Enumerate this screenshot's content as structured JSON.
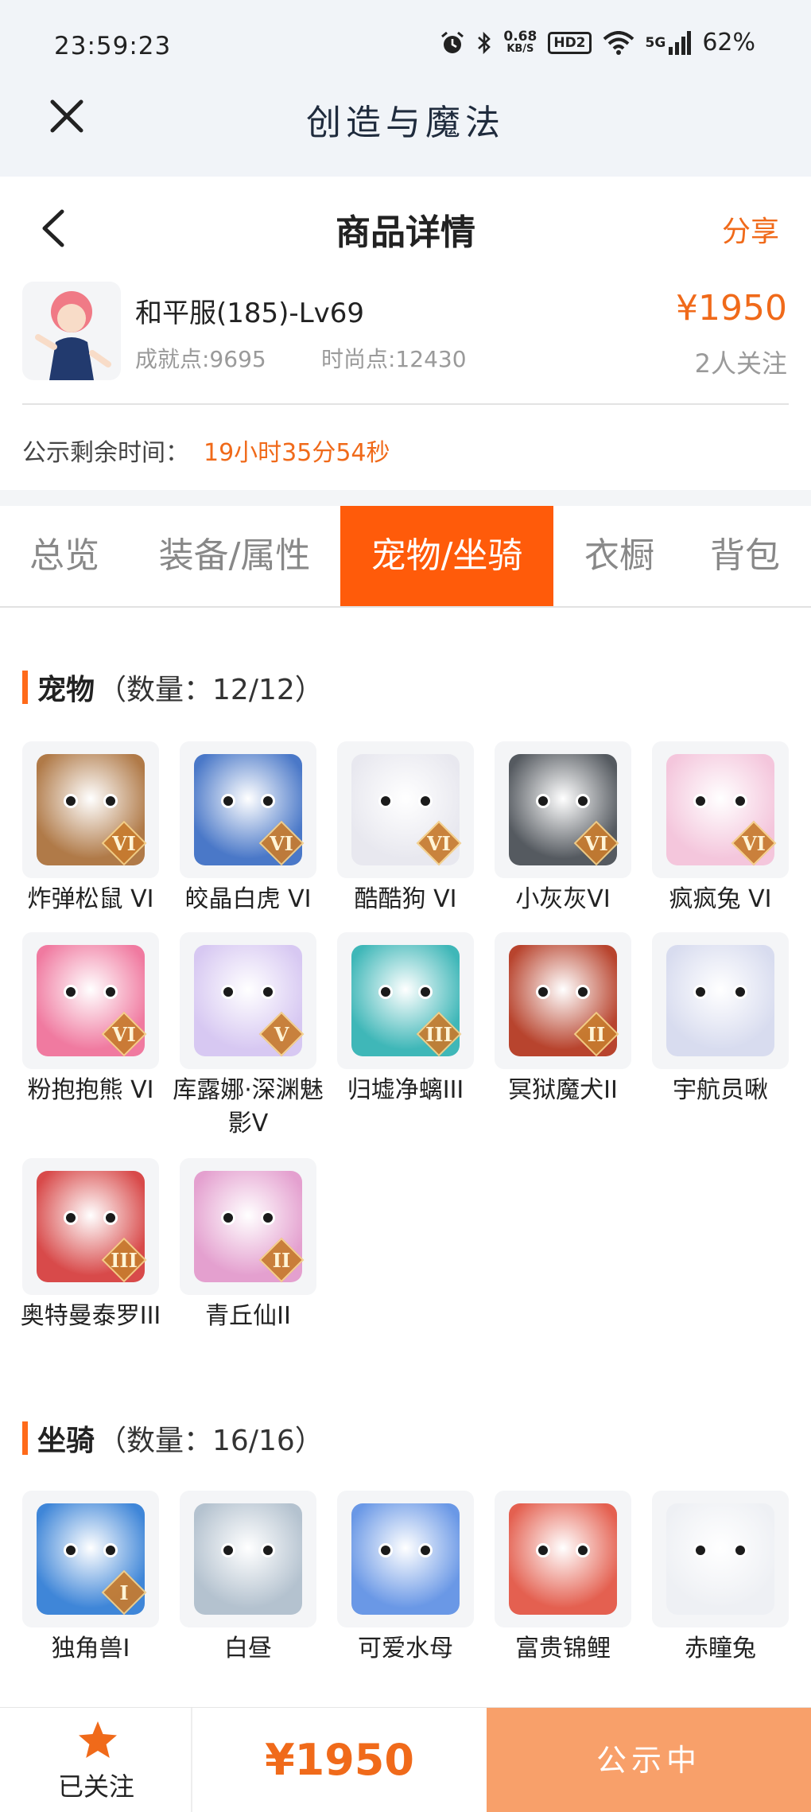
{
  "status_bar": {
    "time": "23:59:23",
    "speed_value": "0.68",
    "speed_unit": "KB/S",
    "hd": "HD2",
    "signal": "5G",
    "battery": "62%"
  },
  "app": {
    "title": "创造与魔法"
  },
  "header": {
    "title": "商品详情",
    "share": "分享"
  },
  "product": {
    "server_level": "和平服(185)-Lv69",
    "achievement": "成就点:9695",
    "fashion": "时尚点:12430",
    "price": "¥1950",
    "watchers": "2人关注",
    "public_label": "公示剩余时间：",
    "public_remaining": "19小时35分54秒"
  },
  "tabs": [
    "总览",
    "装备/属性",
    "宠物/坐骑",
    "衣橱",
    "背包"
  ],
  "active_tab": 2,
  "pets": {
    "title": "宠物",
    "count": "（数量：12/12）",
    "items": [
      {
        "name": "炸弹松鼠 VI",
        "badge": "VI",
        "color": "#b07a48"
      },
      {
        "name": "皎晶白虎 VI",
        "badge": "VI",
        "color": "#4a78c8"
      },
      {
        "name": "酷酷狗 VI",
        "badge": "VI",
        "color": "#e8e8ef"
      },
      {
        "name": "小灰灰VI",
        "badge": "VI",
        "color": "#555a60"
      },
      {
        "name": "疯疯兔 VI",
        "badge": "VI",
        "color": "#f4c6dc"
      },
      {
        "name": "粉抱抱熊 VI",
        "badge": "VI",
        "color": "#f07aa0"
      },
      {
        "name": "库露娜·深渊魅影V",
        "badge": "V",
        "color": "#d7c8f2"
      },
      {
        "name": "归墟净螭III",
        "badge": "III",
        "color": "#3fb7b8"
      },
      {
        "name": "冥狱魔犬II",
        "badge": "II",
        "color": "#b8442e"
      },
      {
        "name": "宇航员啾",
        "badge": "",
        "color": "#d8dcef"
      },
      {
        "name": "奥特曼泰罗III",
        "badge": "III",
        "color": "#d84a4a"
      },
      {
        "name": "青丘仙II",
        "badge": "II",
        "color": "#e4a0cf"
      }
    ]
  },
  "mounts": {
    "title": "坐骑",
    "count": "（数量：16/16）",
    "items": [
      {
        "name": "独角兽I",
        "badge": "I",
        "color": "#3f86d8"
      },
      {
        "name": "白昼",
        "badge": "",
        "color": "#b4c2cf"
      },
      {
        "name": "可爱水母",
        "badge": "",
        "color": "#6a98e6"
      },
      {
        "name": "富贵锦鲤",
        "badge": "",
        "color": "#e46050"
      },
      {
        "name": "赤瞳兔",
        "badge": "",
        "color": "#eef0f4"
      }
    ]
  },
  "bottom_bar": {
    "favorite_label": "已关注",
    "price": "¥1950",
    "status": "公示中"
  },
  "colors": {
    "accent": "#ff5b0a",
    "price": "#f06a1a",
    "status_button": "#f8a06a"
  }
}
